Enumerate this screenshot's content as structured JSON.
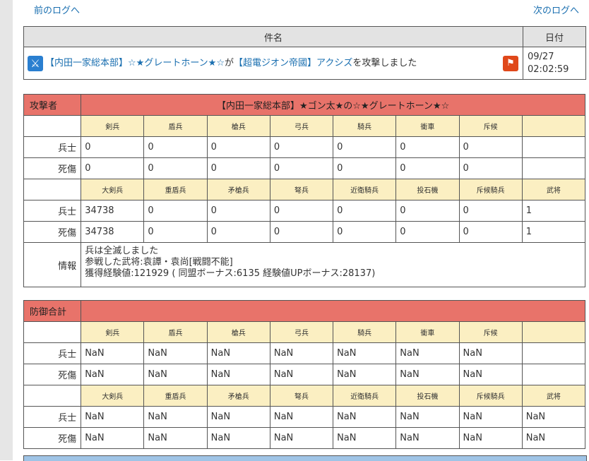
{
  "nav": {
    "prev": "前のログへ",
    "next": "次のログへ"
  },
  "head": {
    "subject_header": "件名",
    "date_header": "日付"
  },
  "entry": {
    "attacker_group": "【内田一家総本部】",
    "attacker_name": "☆★グレートホーン★☆",
    "mid": "が",
    "defender_group": "【超電ジオン帝國】",
    "defender_name": "アクシズ",
    "tail": "を攻撃しました",
    "date": "09/27",
    "time": "02:02:59"
  },
  "attacker": {
    "label": "攻撃者",
    "title": "【内田一家総本部】★ゴン太★の☆★グレートホーン★☆",
    "units1": [
      "剣兵",
      "盾兵",
      "槍兵",
      "弓兵",
      "騎兵",
      "衝車",
      "斥候",
      ""
    ],
    "soldiers1": [
      "0",
      "0",
      "0",
      "0",
      "0",
      "0",
      "0",
      ""
    ],
    "casualties1": [
      "0",
      "0",
      "0",
      "0",
      "0",
      "0",
      "0",
      ""
    ],
    "units2": [
      "大剣兵",
      "重盾兵",
      "矛槍兵",
      "弩兵",
      "近衛騎兵",
      "投石機",
      "斥候騎兵",
      "武将"
    ],
    "soldiers2": [
      "34738",
      "0",
      "0",
      "0",
      "0",
      "0",
      "0",
      "1"
    ],
    "casualties2": [
      "34738",
      "0",
      "0",
      "0",
      "0",
      "0",
      "0",
      "1"
    ],
    "row_soldier": "兵士",
    "row_casualty": "死傷",
    "info_label": "情報",
    "info_lines": [
      "兵は全滅しました",
      "参戦した武将:袁譚・袁尚[戦闘不能]",
      "獲得経験値:121929 ( 同盟ボーナス:6135 経験値UPボーナス:28137)"
    ]
  },
  "defense": {
    "label": "防御合計",
    "units1": [
      "剣兵",
      "盾兵",
      "槍兵",
      "弓兵",
      "騎兵",
      "衝車",
      "斥候",
      ""
    ],
    "soldiers1": [
      "NaN",
      "NaN",
      "NaN",
      "NaN",
      "NaN",
      "NaN",
      "NaN",
      ""
    ],
    "casualties1": [
      "NaN",
      "NaN",
      "NaN",
      "NaN",
      "NaN",
      "NaN",
      "NaN",
      ""
    ],
    "units2": [
      "大剣兵",
      "重盾兵",
      "矛槍兵",
      "弩兵",
      "近衛騎兵",
      "投石機",
      "斥候騎兵",
      "武将"
    ],
    "soldiers2": [
      "NaN",
      "NaN",
      "NaN",
      "NaN",
      "NaN",
      "NaN",
      "NaN",
      "NaN"
    ],
    "casualties2": [
      "NaN",
      "NaN",
      "NaN",
      "NaN",
      "NaN",
      "NaN",
      "NaN",
      "NaN"
    ],
    "row_soldier": "兵士",
    "row_casualty": "死傷"
  },
  "icons": {
    "left": "crossed-swords-icon",
    "right": "running-soldier-icon"
  },
  "colors": {
    "header_red": "#e8736a",
    "unit_cell": "#fbefc2",
    "link": "#1a6fb0"
  }
}
